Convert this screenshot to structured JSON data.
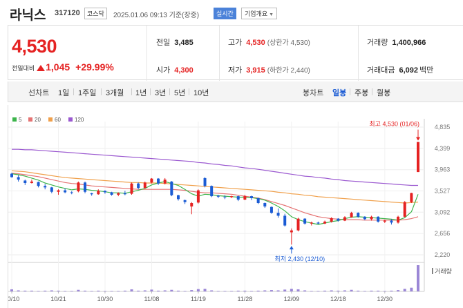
{
  "header": {
    "name": "라닉스",
    "code": "317120",
    "market": "코스닥",
    "datetime": "2025.01.06 09:13",
    "basis": "기준(장중)",
    "realtime": "실시간",
    "overview": "기업개요"
  },
  "summary": {
    "price": "4,530",
    "change_label": "전일대비",
    "change_value": "1,045",
    "change_rate": "+29.99%",
    "prev_close_label": "전일",
    "prev_close": "3,485",
    "high_label": "고가",
    "high": "4,530",
    "upper_limit_label": "(상한가",
    "upper_limit": "4,530)",
    "volume_label": "거래량",
    "volume": "1,400,966",
    "open_label": "시가",
    "open": "4,300",
    "low_label": "저가",
    "low": "3,915",
    "lower_limit_label": "(하한가",
    "lower_limit": "2,440)",
    "value_label": "거래대금",
    "value": "6,092",
    "value_unit": "백만"
  },
  "toolbar": {
    "line_chart": "선차트",
    "periods": [
      "1일",
      "1주일",
      "3개월",
      "1년",
      "3년",
      "5년",
      "10년"
    ],
    "candle_chart": "봉차트",
    "candles": [
      "일봉",
      "주봉",
      "월봉"
    ],
    "active_candle": "일봉"
  },
  "colors": {
    "up": "#e52222",
    "down": "#1a5bd4",
    "ma5": "#3cb44b",
    "ma20": "#e57373",
    "ma60": "#f0a04b",
    "ma120": "#9b59d0",
    "volume": "#9b87d6"
  },
  "chart_data": {
    "type": "candlestick",
    "legend": [
      {
        "name": "5",
        "color": "#3cb44b"
      },
      {
        "name": "20",
        "color": "#e57373"
      },
      {
        "name": "60",
        "color": "#f0a04b"
      },
      {
        "name": "120",
        "color": "#9b59d0"
      }
    ],
    "y_ticks": [
      "4,835",
      "4,399",
      "3,963",
      "3,527",
      "3,092",
      "2,656",
      "2,220"
    ],
    "ylim": [
      2220,
      4835
    ],
    "x_ticks": [
      {
        "label": "10/10",
        "index": 0
      },
      {
        "label": "10/21",
        "index": 7
      },
      {
        "label": "10/30",
        "index": 14
      },
      {
        "label": "11/08",
        "index": 21
      },
      {
        "label": "11/19",
        "index": 28
      },
      {
        "label": "11/28",
        "index": 35
      },
      {
        "label": "12/09",
        "index": 42
      },
      {
        "label": "12/18",
        "index": 49
      },
      {
        "label": "12/30",
        "index": 56
      }
    ],
    "annotations": {
      "high_label": "최고 4,530 (01/06)",
      "low_label": "최저 2,430 (12/10)"
    },
    "volume_label": "거래량",
    "candles": [
      [
        3880,
        3900,
        3800,
        3810
      ],
      [
        3810,
        3850,
        3720,
        3760
      ],
      [
        3740,
        3760,
        3650,
        3690
      ],
      [
        3690,
        3760,
        3680,
        3720
      ],
      [
        3710,
        3720,
        3600,
        3630
      ],
      [
        3630,
        3670,
        3560,
        3600
      ],
      [
        3600,
        3610,
        3480,
        3510
      ],
      [
        3510,
        3560,
        3450,
        3540
      ],
      [
        3540,
        3580,
        3480,
        3500
      ],
      [
        3500,
        3520,
        3460,
        3490
      ],
      [
        3520,
        3720,
        3500,
        3700
      ],
      [
        3700,
        3720,
        3480,
        3510
      ],
      [
        3480,
        3490,
        3430,
        3460
      ],
      [
        3460,
        3560,
        3450,
        3530
      ],
      [
        3530,
        3540,
        3470,
        3500
      ],
      [
        3500,
        3510,
        3430,
        3450
      ],
      [
        3450,
        3500,
        3420,
        3480
      ],
      [
        3480,
        3530,
        3440,
        3460
      ],
      [
        3470,
        3700,
        3450,
        3680
      ],
      [
        3680,
        3700,
        3560,
        3590
      ],
      [
        3590,
        3720,
        3580,
        3700
      ],
      [
        3700,
        3790,
        3680,
        3780
      ],
      [
        3780,
        3790,
        3650,
        3680
      ],
      [
        3680,
        3790,
        3660,
        3760
      ],
      [
        3720,
        3730,
        3420,
        3440
      ],
      [
        3440,
        3450,
        3330,
        3360
      ],
      [
        3340,
        3350,
        3260,
        3300
      ],
      [
        3210,
        3300,
        3050,
        3280
      ],
      [
        3290,
        3560,
        3270,
        3540
      ],
      [
        3790,
        3810,
        3600,
        3630
      ],
      [
        3630,
        3640,
        3400,
        3420
      ],
      [
        3430,
        3450,
        3380,
        3410
      ],
      [
        3410,
        3440,
        3360,
        3400
      ],
      [
        3400,
        3430,
        3380,
        3420
      ],
      [
        3420,
        3430,
        3320,
        3350
      ],
      [
        3350,
        3450,
        3340,
        3420
      ],
      [
        3420,
        3430,
        3340,
        3380
      ],
      [
        3380,
        3390,
        3260,
        3280
      ],
      [
        3280,
        3290,
        3180,
        3210
      ],
      [
        3200,
        3210,
        3060,
        3080
      ],
      [
        3080,
        3170,
        2980,
        3020
      ],
      [
        3020,
        3060,
        2800,
        2820
      ],
      [
        2680,
        2760,
        2430,
        2720
      ],
      [
        2720,
        2980,
        2700,
        2960
      ],
      [
        2960,
        2970,
        2840,
        2860
      ],
      [
        2860,
        2900,
        2820,
        2880
      ],
      [
        2880,
        2900,
        2850,
        2860
      ],
      [
        2860,
        2920,
        2850,
        2900
      ],
      [
        2900,
        2990,
        2880,
        2970
      ],
      [
        2960,
        2970,
        2900,
        2920
      ],
      [
        2920,
        3010,
        2910,
        2990
      ],
      [
        2990,
        3100,
        2980,
        3080
      ],
      [
        3080,
        3090,
        2980,
        3000
      ],
      [
        3000,
        3010,
        2930,
        2950
      ],
      [
        2950,
        3020,
        2920,
        3000
      ],
      [
        3000,
        3010,
        2880,
        2900
      ],
      [
        2900,
        2940,
        2870,
        2920
      ],
      [
        2920,
        2950,
        2840,
        2880
      ],
      [
        2880,
        3020,
        2860,
        3000
      ],
      [
        3000,
        3320,
        2990,
        3300
      ],
      [
        3300,
        3490,
        3280,
        3485
      ],
      [
        3915,
        4530,
        3915,
        4530
      ]
    ],
    "ma_series": [
      {
        "name": "5",
        "values": [
          3880,
          3860,
          3830,
          3790,
          3750,
          3690,
          3650,
          3610,
          3580,
          3550,
          3570,
          3560,
          3540,
          3530,
          3510,
          3490,
          3490,
          3480,
          3510,
          3540,
          3580,
          3650,
          3690,
          3720,
          3680,
          3640,
          3560,
          3470,
          3420,
          3460,
          3450,
          3430,
          3420,
          3410,
          3400,
          3400,
          3390,
          3370,
          3340,
          3280,
          3210,
          3120,
          3000,
          2940,
          2900,
          2870,
          2840,
          2870,
          2900,
          2920,
          2960,
          2990,
          3000,
          2990,
          2980,
          2970,
          2960,
          2950,
          2930,
          2980,
          3100,
          3460
        ]
      },
      {
        "name": "20",
        "values": [
          3890,
          3880,
          3860,
          3840,
          3820,
          3790,
          3760,
          3730,
          3700,
          3680,
          3670,
          3650,
          3630,
          3620,
          3610,
          3600,
          3590,
          3580,
          3570,
          3560,
          3560,
          3560,
          3560,
          3560,
          3560,
          3550,
          3540,
          3520,
          3500,
          3490,
          3490,
          3480,
          3470,
          3460,
          3440,
          3420,
          3400,
          3380,
          3350,
          3310,
          3270,
          3230,
          3180,
          3130,
          3080,
          3040,
          3000,
          2980,
          2960,
          2950,
          2940,
          2940,
          2940,
          2930,
          2930,
          2930,
          2930,
          2930,
          2930,
          2940,
          2960,
          3000
        ]
      },
      {
        "name": "60",
        "values": [
          3940,
          3930,
          3920,
          3900,
          3880,
          3860,
          3840,
          3820,
          3800,
          3790,
          3780,
          3770,
          3760,
          3750,
          3740,
          3730,
          3720,
          3710,
          3700,
          3700,
          3690,
          3690,
          3690,
          3680,
          3670,
          3660,
          3650,
          3640,
          3630,
          3620,
          3610,
          3600,
          3590,
          3580,
          3570,
          3560,
          3550,
          3540,
          3530,
          3520,
          3500,
          3490,
          3470,
          3460,
          3440,
          3430,
          3410,
          3400,
          3390,
          3380,
          3370,
          3360,
          3350,
          3340,
          3330,
          3320,
          3310,
          3300,
          3290,
          3280,
          3290,
          3300
        ]
      },
      {
        "name": "120",
        "values": [
          4380,
          4380,
          4370,
          4370,
          4360,
          4350,
          4340,
          4330,
          4320,
          4310,
          4300,
          4290,
          4280,
          4270,
          4260,
          4250,
          4240,
          4230,
          4220,
          4210,
          4200,
          4190,
          4180,
          4170,
          4160,
          4150,
          4140,
          4130,
          4110,
          4100,
          4080,
          4070,
          4050,
          4040,
          4020,
          4000,
          3990,
          3970,
          3950,
          3930,
          3910,
          3890,
          3870,
          3850,
          3830,
          3820,
          3800,
          3790,
          3770,
          3760,
          3740,
          3730,
          3720,
          3710,
          3700,
          3690,
          3680,
          3670,
          3660,
          3650,
          3640,
          3640
        ]
      }
    ],
    "volumes": [
      0.08,
      0.04,
      0.03,
      0.03,
      0.02,
      0.03,
      0.04,
      0.03,
      0.02,
      0.02,
      0.06,
      0.03,
      0.02,
      0.03,
      0.02,
      0.02,
      0.02,
      0.03,
      0.08,
      0.03,
      0.04,
      0.07,
      0.03,
      0.04,
      0.06,
      0.03,
      0.02,
      0.05,
      0.09,
      0.1,
      0.04,
      0.02,
      0.02,
      0.02,
      0.03,
      0.03,
      0.02,
      0.03,
      0.04,
      0.05,
      0.04,
      0.07,
      0.1,
      0.08,
      0.04,
      0.02,
      0.02,
      0.03,
      0.04,
      0.03,
      0.04,
      0.06,
      0.03,
      0.02,
      0.03,
      0.03,
      0.02,
      0.03,
      0.05,
      0.1,
      0.14,
      1.0
    ]
  }
}
